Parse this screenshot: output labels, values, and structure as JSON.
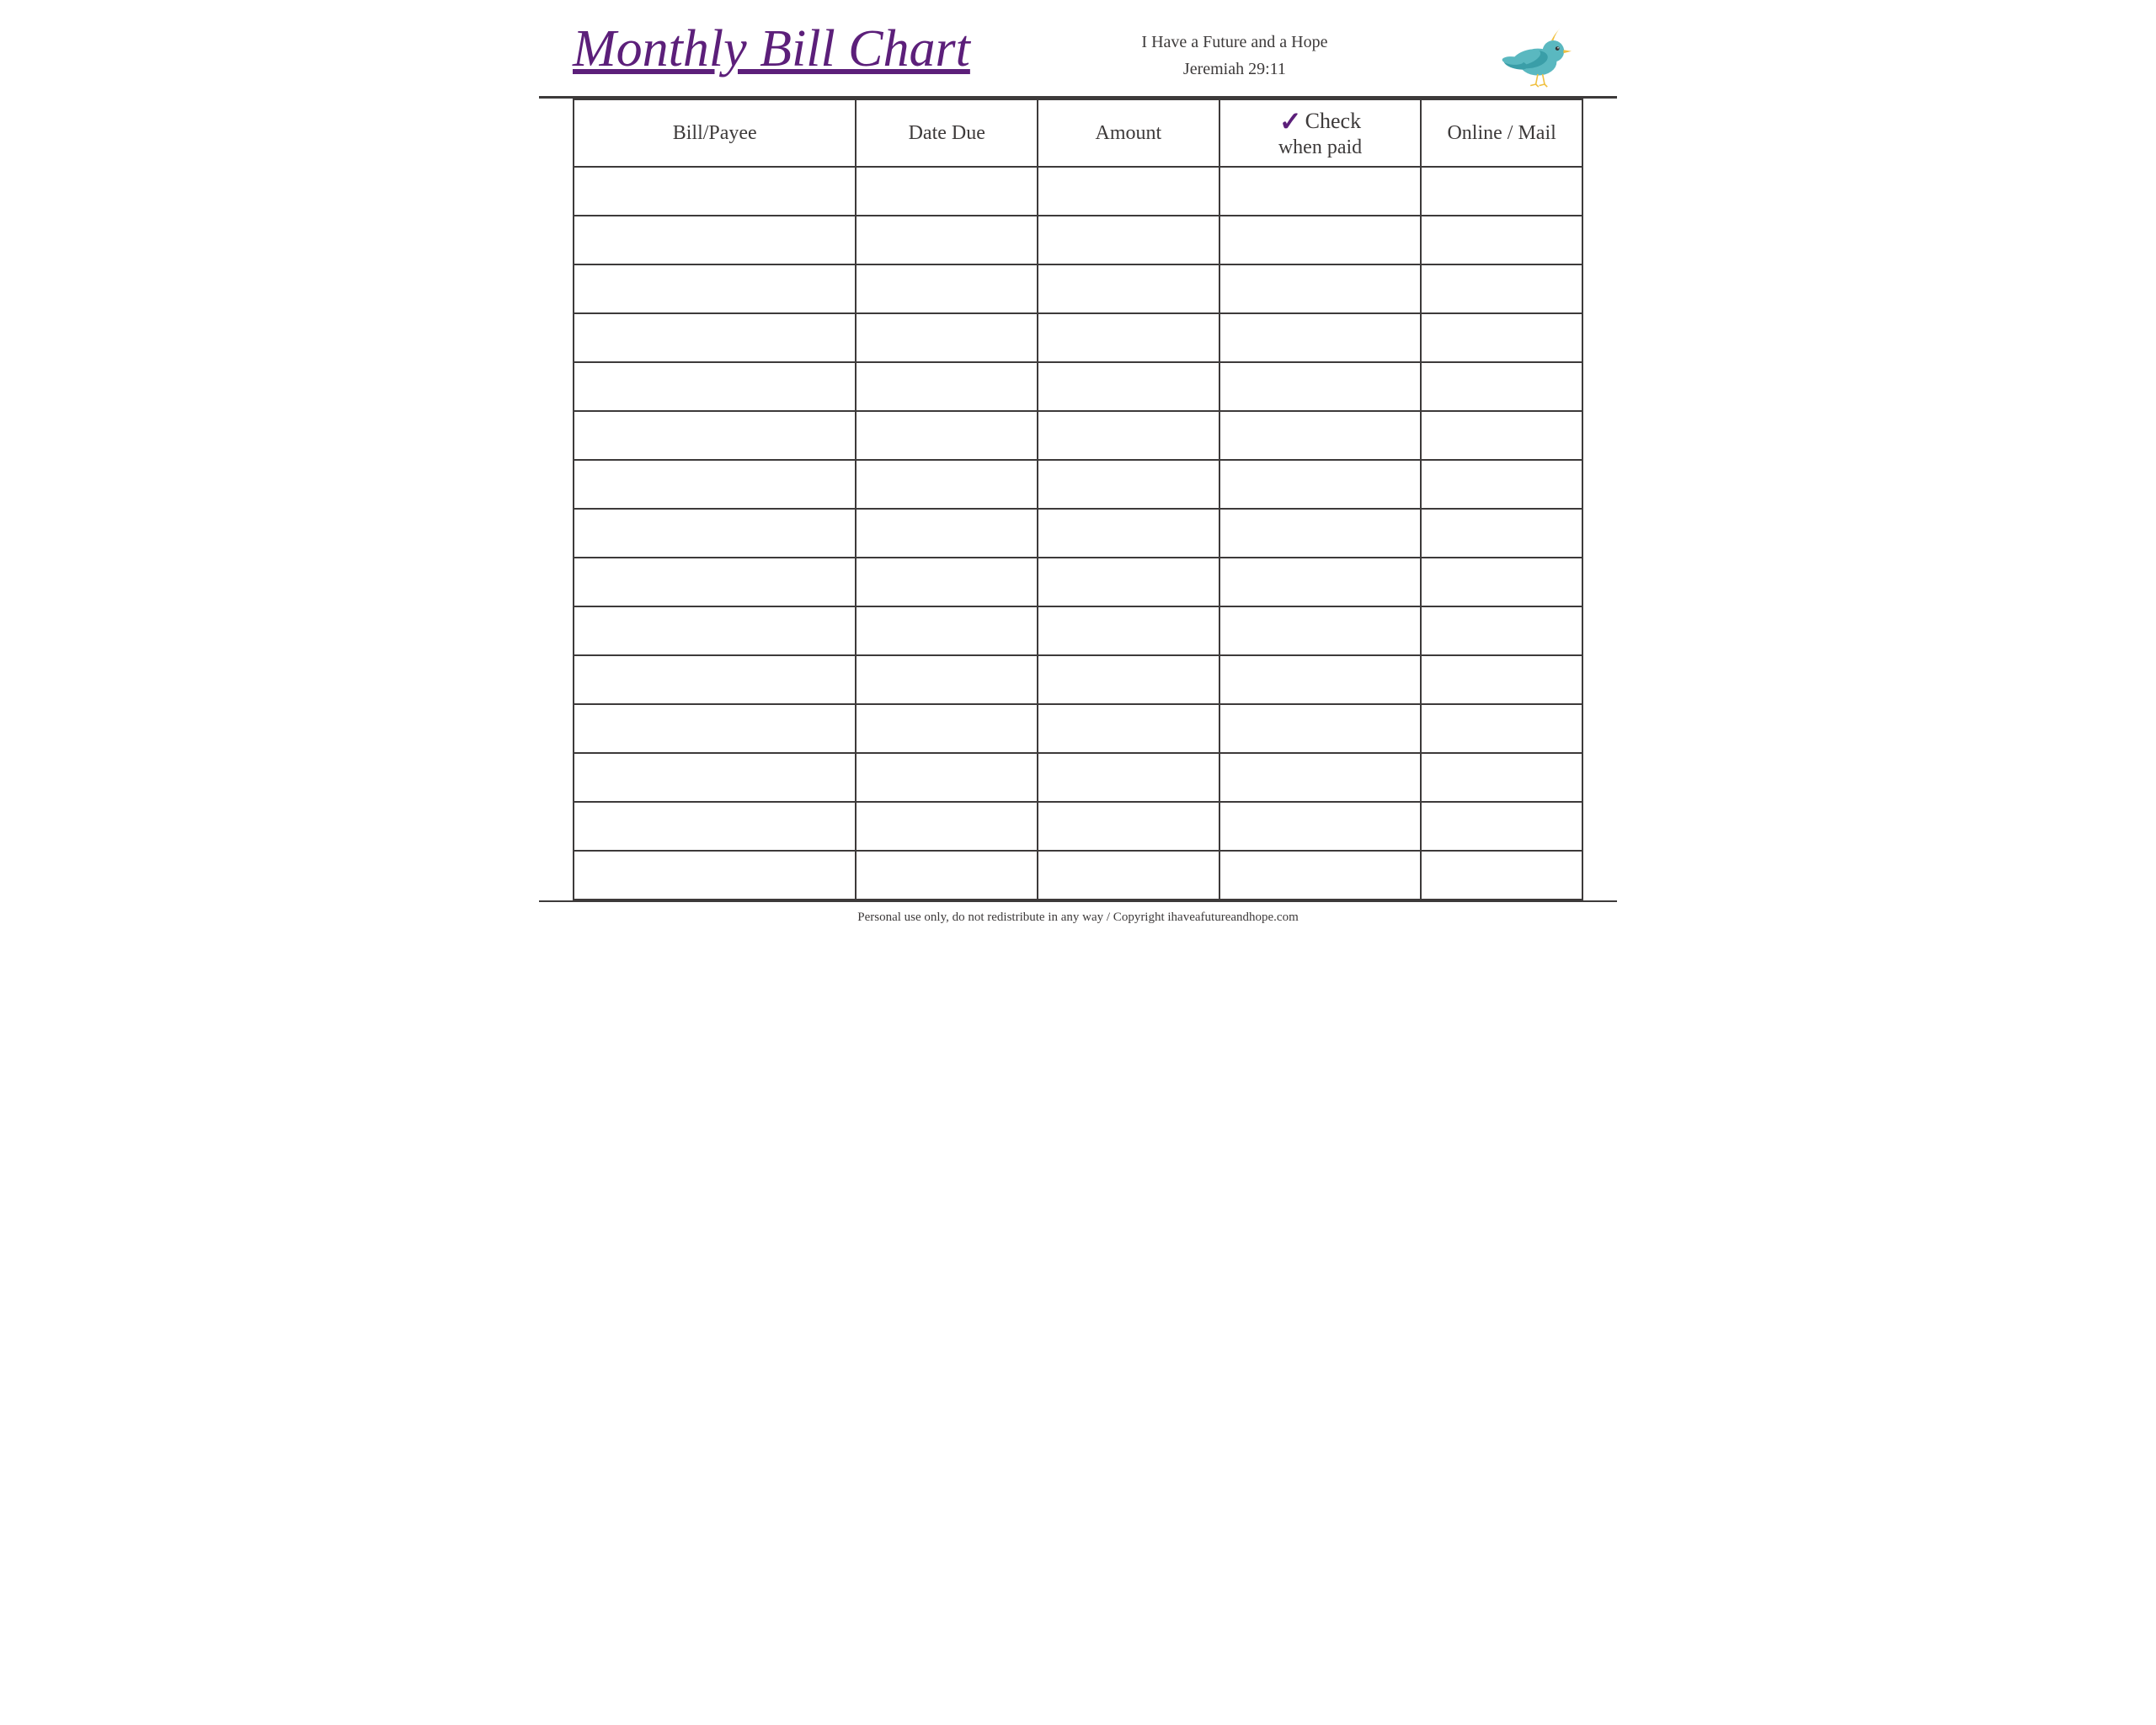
{
  "header": {
    "title": "Monthly Bill Chart",
    "subtitle_line1": "I Have a Future and a Hope",
    "subtitle_line2": "Jeremiah 29:11"
  },
  "table": {
    "columns": [
      {
        "id": "payee",
        "label": "Bill/Payee"
      },
      {
        "id": "date",
        "label": "Date Due"
      },
      {
        "id": "amount",
        "label": "Amount"
      },
      {
        "id": "check",
        "label_top": "Check",
        "label_bottom": "when paid",
        "checkmark": "✓"
      },
      {
        "id": "online",
        "label": "Online / Mail"
      }
    ],
    "row_count": 15
  },
  "footer": {
    "text": "Personal use only, do not redistribute in any way / Copyright ihaveafutureandhope.com"
  }
}
